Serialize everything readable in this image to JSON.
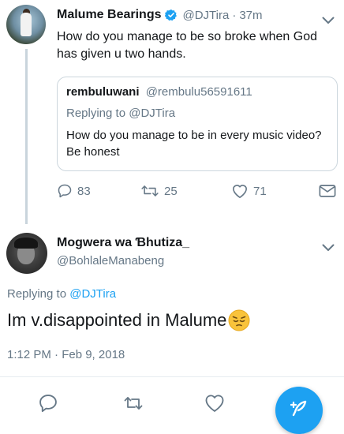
{
  "parent_tweet": {
    "display_name": "Malume Bearings",
    "handle": "@DJTira",
    "separator": "·",
    "time_ago": "37m",
    "text": "How do you manage to be so broke when God has given u two hands.",
    "quoted": {
      "display_name": "rembuluwani",
      "handle": "@rembulu56591611",
      "replying_to": "Replying to @DJTira",
      "text": "How do you manage to be in every music video? Be honest"
    },
    "actions": {
      "reply_count": "83",
      "retweet_count": "25",
      "like_count": "71"
    }
  },
  "reply_tweet": {
    "display_name": "Mogwera wa Ɓhutiza_",
    "handle": "@BohlaleManabeng",
    "replying_prefix": "Replying to",
    "replying_mention": "@DJTira",
    "text": "Im v.disappointed in Malume",
    "emoji": "pensive-face",
    "timestamp": "1:12 PM · Feb 9, 2018"
  },
  "icons": {
    "verified": "verified-badge-icon",
    "chevron": "chevron-down-icon",
    "reply": "reply-icon",
    "retweet": "retweet-icon",
    "like": "heart-icon",
    "dm": "envelope-icon",
    "compose": "compose-feather-icon"
  },
  "colors": {
    "accent": "#1da1f2",
    "secondary_text": "#657786",
    "primary_text": "#14171a",
    "border": "#ccd6dd"
  }
}
